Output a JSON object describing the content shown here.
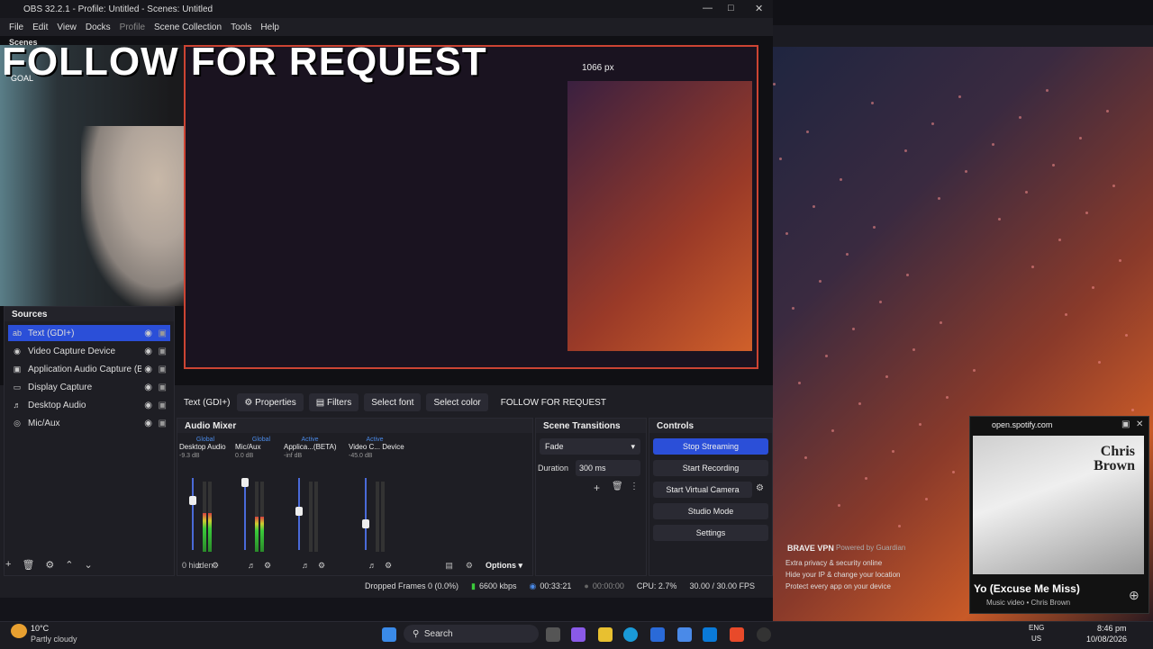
{
  "obs": {
    "title": "OBS 32.2.1 - Profile: Untitled - Scenes: Untitled",
    "menu": [
      "File",
      "Edit",
      "View",
      "Docks",
      "Profile",
      "Scene Collection",
      "Tools",
      "Help"
    ],
    "preview": {
      "overlay_text": "FOLLOW FOR REQUEST",
      "goal_label": "GOAL",
      "scenes_label": "Scenes",
      "px_label": "1066 px"
    },
    "sources": {
      "title": "Sources",
      "items": [
        {
          "label": "Text (GDI+)",
          "icon": "text-icon",
          "selected": true
        },
        {
          "label": "Video Capture Device",
          "icon": "camera-icon",
          "selected": false
        },
        {
          "label": "Application Audio Capture (BETA)",
          "icon": "app-audio-icon",
          "selected": false
        },
        {
          "label": "Display Capture",
          "icon": "monitor-icon",
          "selected": false
        },
        {
          "label": "Desktop Audio",
          "icon": "speaker-icon",
          "selected": false
        },
        {
          "label": "Mic/Aux",
          "icon": "mic-icon",
          "selected": false
        }
      ]
    },
    "context_bar": {
      "source_name": "Text (GDI+)",
      "properties": "Properties",
      "filters": "Filters",
      "select_font": "Select font",
      "select_color": "Select color",
      "text_value": "FOLLOW FOR REQUEST"
    },
    "audio_mixer": {
      "title": "Audio Mixer",
      "channels": [
        {
          "name": "Desktop Audio",
          "state": "Global",
          "db": "-9.3 dB",
          "level": 0.55,
          "fader": 0.72
        },
        {
          "name": "Mic/Aux",
          "state": "Global",
          "db": "0.0 dB",
          "level": 0.5,
          "fader": 1.0
        },
        {
          "name": "Applica...(BETA)",
          "state": "Active",
          "db": "-inf dB",
          "level": 0.0,
          "fader": 0.55
        },
        {
          "name": "Video C... Device",
          "state": "Active",
          "db": "-45.0 dB",
          "level": 0.0,
          "fader": 0.35
        }
      ],
      "hidden_label": "0 hidden",
      "options_label": "Options"
    },
    "transitions": {
      "title": "Scene Transitions",
      "selected": "Fade",
      "duration_label": "Duration",
      "duration_value": "300 ms"
    },
    "controls": {
      "title": "Controls",
      "stop_streaming": "Stop Streaming",
      "start_recording": "Start Recording",
      "start_virtual_camera": "Start Virtual Camera",
      "studio_mode": "Studio Mode",
      "settings": "Settings"
    },
    "status": {
      "dropped": "Dropped Frames 0 (0.0%)",
      "bitrate": "6600 kbps",
      "stream_time": "00:33:21",
      "rec_time": "00:00:00",
      "cpu": "CPU: 2.7%",
      "fps": "30.00 / 30.00 FPS"
    }
  },
  "spotify": {
    "domain": "open.spotify.com",
    "song": "Yo (Excuse Me Miss)",
    "subtitle": "Music video • Chris Brown",
    "art_text": "Chris Brown"
  },
  "brave": {
    "title": "BRAVE VPN",
    "powered": "Powered by Guardian",
    "lines": [
      "Extra privacy & security online",
      "Hide your IP & change your location",
      "Protect every app on your device"
    ]
  },
  "taskbar": {
    "weather_temp": "10°C",
    "weather_desc": "Partly cloudy",
    "search": "Search",
    "lang": "ENG",
    "region": "US",
    "time": "8:46 pm",
    "date": "10/08/2026"
  },
  "colors": {
    "accent": "#2b4fd8",
    "obs_bg": "#1e1e24",
    "record_red": "#c43"
  }
}
